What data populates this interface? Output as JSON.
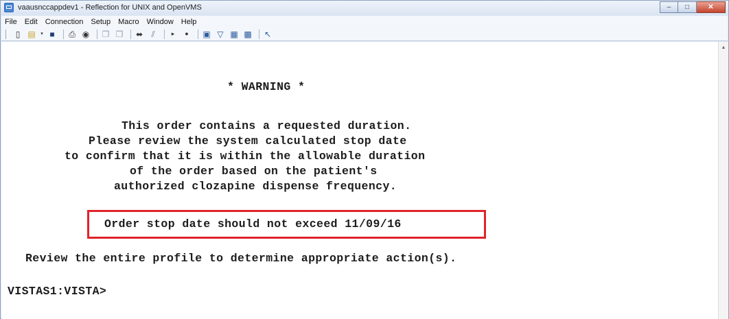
{
  "window": {
    "title": "vaausnccappdev1 - Reflection for UNIX and OpenVMS",
    "controls": [
      "minimize",
      "maximize",
      "close"
    ]
  },
  "menu": {
    "items": [
      "File",
      "Edit",
      "Connection",
      "Setup",
      "Macro",
      "Window",
      "Help"
    ]
  },
  "toolbar": {
    "icons": [
      "new-document-icon",
      "open-folder-icon",
      "save-icon",
      "print-icon",
      "find-icon",
      "copy-icon",
      "paste-icon",
      "connect-icon",
      "disconnect-icon",
      "play-icon",
      "record-icon",
      "display-icon",
      "keyboard-icon",
      "settings-icon",
      "grid-icon",
      "help-pointer-icon"
    ]
  },
  "terminal": {
    "warning": "* WARNING *",
    "message_lines": [
      "This order contains a requested duration.",
      "Please review the system calculated stop date",
      "to confirm that it is within the allowable duration",
      "of the order based on the patient's",
      "authorized clozapine dispense frequency."
    ],
    "stop_date_notice": "Order stop date should not exceed 11/09/16",
    "review_line": "Review the entire profile to determine appropriate action(s).",
    "prompt": "VISTAS1:VISTA>"
  },
  "colors": {
    "highlight_border": "#e0232b",
    "terminal_background": "#ffffff",
    "terminal_text": "#1c1c1c"
  }
}
